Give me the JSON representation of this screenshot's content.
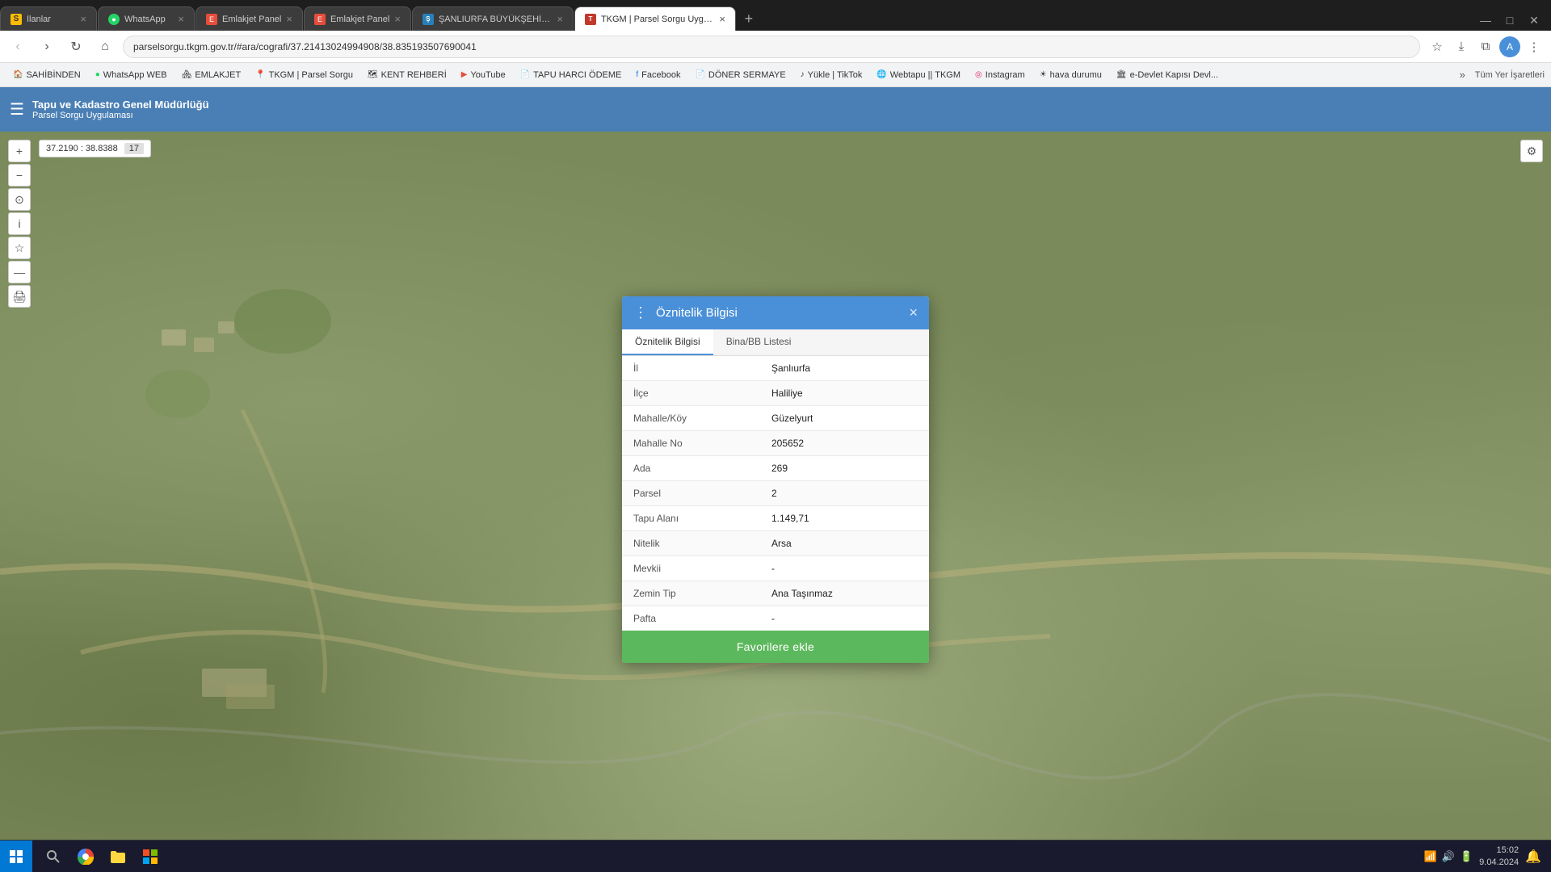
{
  "browser": {
    "tabs": [
      {
        "id": "t1",
        "title": "İlanlar",
        "favicon_text": "S",
        "favicon_color": "#fbbc04",
        "active": false
      },
      {
        "id": "t2",
        "title": "WhatsApp",
        "favicon_text": "W",
        "favicon_color": "#25d366",
        "active": false
      },
      {
        "id": "t3",
        "title": "Emlakjet Panel",
        "favicon_text": "E",
        "favicon_color": "#e74c3c",
        "active": false
      },
      {
        "id": "t4",
        "title": "Emlakjet Panel",
        "favicon_text": "E",
        "favicon_color": "#e74c3c",
        "active": false
      },
      {
        "id": "t5",
        "title": "ŞANLIURFA BÜYÜKŞEHİR BELE...",
        "favicon_text": "Ş",
        "favicon_color": "#2980b9",
        "active": false
      },
      {
        "id": "t6",
        "title": "TKGM | Parsel Sorgu Uygulama...",
        "favicon_text": "T",
        "favicon_color": "#c0392b",
        "active": true
      }
    ],
    "url": "parselsorgu.tkgm.gov.tr/#ara/cografi/37.21413024994908/38.835193507690041",
    "zoom": "17"
  },
  "bookmarks": [
    {
      "label": "SAHİBİNDEN",
      "icon": "house"
    },
    {
      "label": "WhatsApp WEB",
      "icon": "wa"
    },
    {
      "label": "EMLAKJET",
      "icon": "home"
    },
    {
      "label": "TKGM | Parsel Sorgu",
      "icon": "map"
    },
    {
      "label": "KENT REHBERİ",
      "icon": "map"
    },
    {
      "label": "YouTube",
      "icon": "play"
    },
    {
      "label": "TAPU HARCI ÖDEME",
      "icon": "doc"
    },
    {
      "label": "Facebook",
      "icon": "fb"
    },
    {
      "label": "DÖNER SERMAYE",
      "icon": "doc"
    },
    {
      "label": "Yükle | TikTok",
      "icon": "tok"
    },
    {
      "label": "Webtapu || TKGM",
      "icon": "map"
    },
    {
      "label": "Instagram",
      "icon": "insta"
    },
    {
      "label": "hava durumu",
      "icon": "sun"
    },
    {
      "label": "e-Devlet Kapısı Devl...",
      "icon": "doc"
    }
  ],
  "map_toolbar": {
    "title": "Tapu ve Kadastro Genel Müdürlüğü",
    "subtitle": "Parsel Sorgu Uygulaması"
  },
  "map_coords": "37.2190 : 38.8388",
  "map_zoom": "17",
  "modal": {
    "title": "Öznitelik Bilgisi",
    "tabs": [
      {
        "label": "Öznitelik Bilgisi",
        "active": true
      },
      {
        "label": "Bina/BB Listesi",
        "active": false
      }
    ],
    "fields": [
      {
        "label": "İl",
        "value": "Şanlıurfa"
      },
      {
        "label": "İlçe",
        "value": "Haliliye"
      },
      {
        "label": "Mahalle/Köy",
        "value": "Güzelyurt"
      },
      {
        "label": "Mahalle No",
        "value": "205652"
      },
      {
        "label": "Ada",
        "value": "269"
      },
      {
        "label": "Parsel",
        "value": "2"
      },
      {
        "label": "Tapu Alanı",
        "value": "1.149,71"
      },
      {
        "label": "Nitelik",
        "value": "Arsa"
      },
      {
        "label": "Mevkii",
        "value": "-"
      },
      {
        "label": "Zemin Tip",
        "value": "Ana Taşınmaz"
      },
      {
        "label": "Pafta",
        "value": "-"
      }
    ],
    "favorites_btn": "Favorilere ekle",
    "close_icon": "×",
    "menu_icon": "⋮"
  },
  "taskbar": {
    "time": "15:02",
    "date": "9.04.2024"
  },
  "tum_yer": "Tüm Yer İşaretleri"
}
